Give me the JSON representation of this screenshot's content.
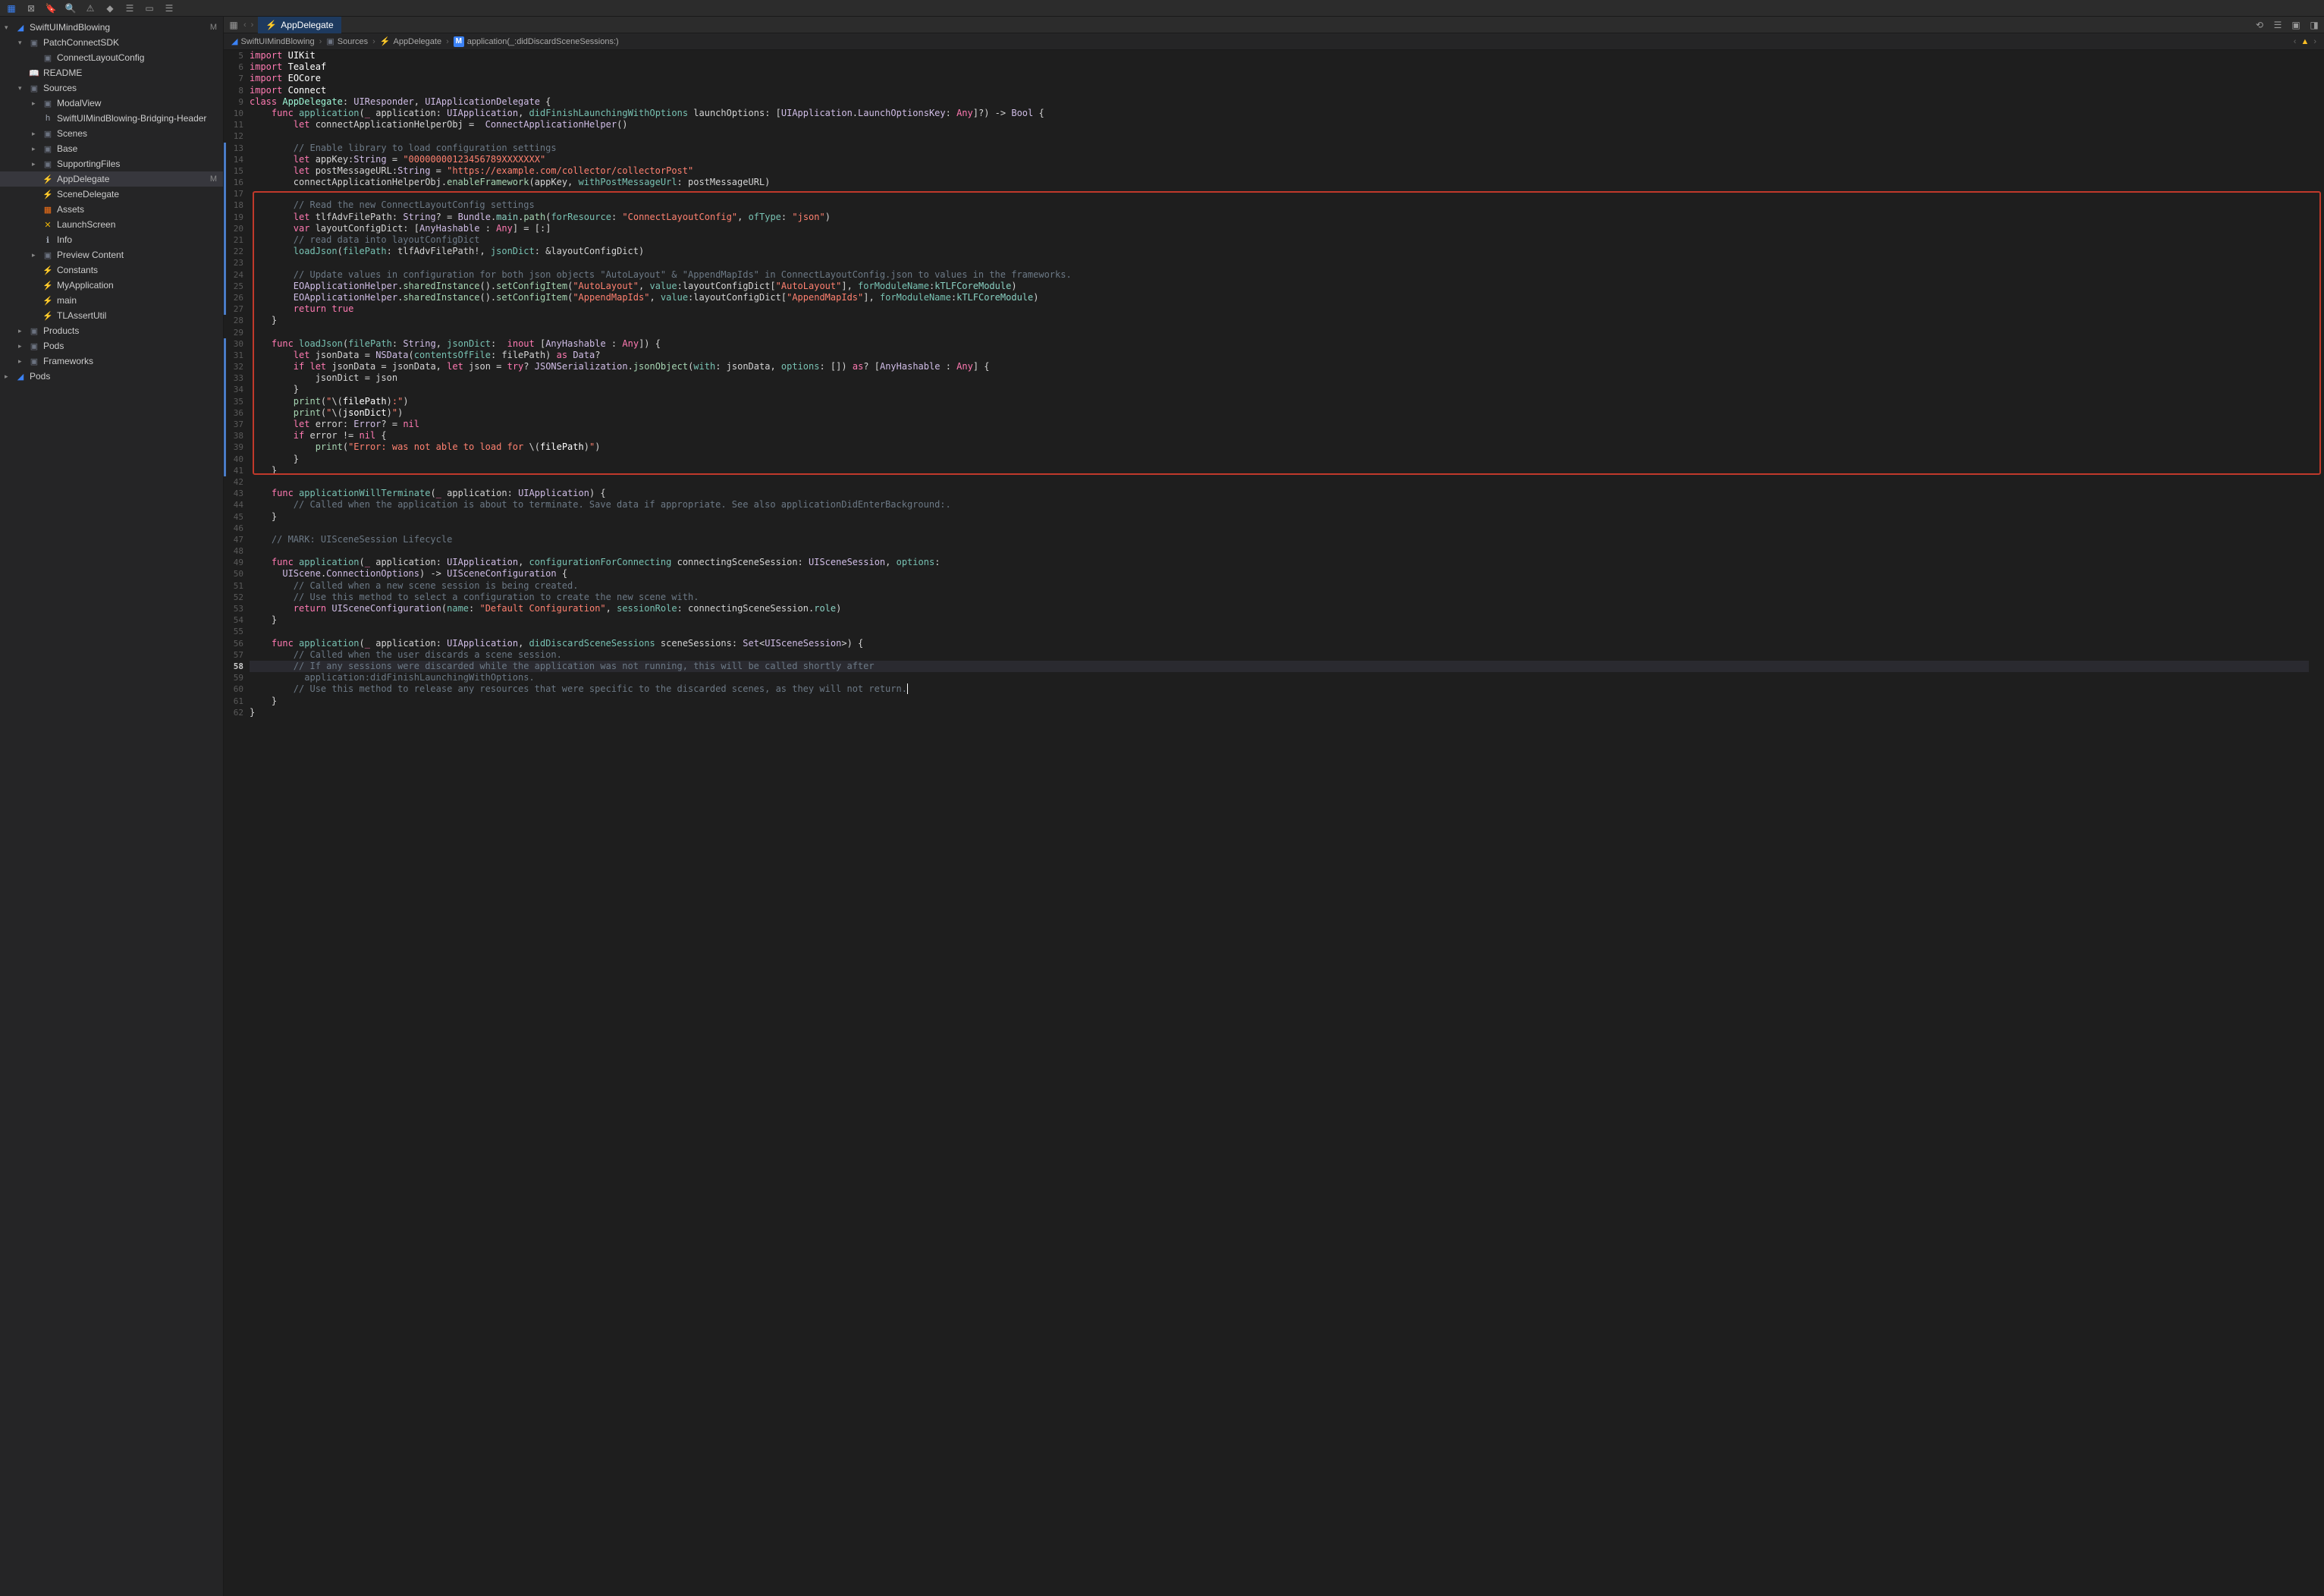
{
  "toolbar": {
    "icons": [
      "square-blue",
      "x-square",
      "bookmark",
      "search",
      "warning",
      "diamond",
      "git",
      "debug",
      "viewer",
      "list"
    ]
  },
  "editorToolbar": {
    "tabLabel": "AppDelegate"
  },
  "breadcrumb": {
    "root": "SwiftUIMindBlowing",
    "folder": "Sources",
    "file": "AppDelegate",
    "method": "application(_:didDiscardSceneSessions:)",
    "nav": {
      "prev": "‹",
      "next": "›"
    },
    "warnIcon": "warning-triangle"
  },
  "sidebar": {
    "items": [
      {
        "indent": 0,
        "chev": "▾",
        "iconClass": "icon-xcode",
        "icon": "◢",
        "label": "SwiftUIMindBlowing",
        "m": "M"
      },
      {
        "indent": 1,
        "chev": "▾",
        "iconClass": "icon-folder",
        "icon": "▣",
        "label": "PatchConnectSDK"
      },
      {
        "indent": 2,
        "chev": "",
        "iconClass": "icon-folder",
        "icon": "▣",
        "label": "ConnectLayoutConfig"
      },
      {
        "indent": 1,
        "chev": "",
        "iconClass": "icon-readme",
        "icon": "📖",
        "label": "README"
      },
      {
        "indent": 1,
        "chev": "▾",
        "iconClass": "icon-folder",
        "icon": "▣",
        "label": "Sources"
      },
      {
        "indent": 2,
        "chev": "▸",
        "iconClass": "icon-folder",
        "icon": "▣",
        "label": "ModalView"
      },
      {
        "indent": 2,
        "chev": "",
        "iconClass": "icon-h",
        "icon": "h",
        "label": "SwiftUIMindBlowing-Bridging-Header"
      },
      {
        "indent": 2,
        "chev": "▸",
        "iconClass": "icon-folder",
        "icon": "▣",
        "label": "Scenes"
      },
      {
        "indent": 2,
        "chev": "▸",
        "iconClass": "icon-folder",
        "icon": "▣",
        "label": "Base"
      },
      {
        "indent": 2,
        "chev": "▸",
        "iconClass": "icon-folder",
        "icon": "▣",
        "label": "SupportingFiles"
      },
      {
        "indent": 2,
        "chev": "",
        "iconClass": "icon-swift",
        "icon": "⚡",
        "label": "AppDelegate",
        "m": "M",
        "selected": true
      },
      {
        "indent": 2,
        "chev": "",
        "iconClass": "icon-swift",
        "icon": "⚡",
        "label": "SceneDelegate"
      },
      {
        "indent": 2,
        "chev": "",
        "iconClass": "icon-assets",
        "icon": "▦",
        "label": "Assets"
      },
      {
        "indent": 2,
        "chev": "",
        "iconClass": "icon-launch",
        "icon": "✕",
        "label": "LaunchScreen"
      },
      {
        "indent": 2,
        "chev": "",
        "iconClass": "icon-h",
        "icon": "ℹ",
        "label": "Info"
      },
      {
        "indent": 2,
        "chev": "▸",
        "iconClass": "icon-folder",
        "icon": "▣",
        "label": "Preview Content"
      },
      {
        "indent": 2,
        "chev": "",
        "iconClass": "icon-swift",
        "icon": "⚡",
        "label": "Constants"
      },
      {
        "indent": 2,
        "chev": "",
        "iconClass": "icon-swift",
        "icon": "⚡",
        "label": "MyApplication"
      },
      {
        "indent": 2,
        "chev": "",
        "iconClass": "icon-swift",
        "icon": "⚡",
        "label": "main"
      },
      {
        "indent": 2,
        "chev": "",
        "iconClass": "icon-swift",
        "icon": "⚡",
        "label": "TLAssertUtil"
      },
      {
        "indent": 1,
        "chev": "▸",
        "iconClass": "icon-folder",
        "icon": "▣",
        "label": "Products"
      },
      {
        "indent": 1,
        "chev": "▸",
        "iconClass": "icon-folder",
        "icon": "▣",
        "label": "Pods"
      },
      {
        "indent": 1,
        "chev": "▸",
        "iconClass": "icon-folder",
        "icon": "▣",
        "label": "Frameworks"
      },
      {
        "indent": 0,
        "chev": "▸",
        "iconClass": "icon-xcode",
        "icon": "◢",
        "label": "Pods"
      }
    ]
  },
  "code": {
    "startLine": 5,
    "currentLine": 58,
    "changeBars": [
      [
        13,
        16
      ],
      [
        17,
        27
      ],
      [
        30,
        41
      ]
    ],
    "highlightBox": {
      "startLine": 17,
      "endLine": 42
    },
    "lines": [
      "<span class='kw'>import</span> <span class='id'>UIKit</span>",
      "<span class='kw'>import</span> <span class='id'>Tealeaf</span>",
      "<span class='kw'>import</span> <span class='id'>EOCore</span>",
      "<span class='kw'>import</span> <span class='id'>Connect</span>",
      "<span class='kw'>class</span> <span class='type'>AppDelegate</span>: <span class='type2'>UIResponder</span>, <span class='type2'>UIApplicationDelegate</span> {",
      "    <span class='kw'>func</span> <span class='fn'>application</span>(<span class='kw'>_</span> application: <span class='type2'>UIApplication</span>, <span class='param'>didFinishLaunchingWithOptions</span> launchOptions: [<span class='type2'>UIApplication</span>.<span class='type2'>LaunchOptionsKey</span>: <span class='kw'>Any</span>]?) -> <span class='type2'>Bool</span> {",
      "        <span class='kw'>let</span> connectApplicationHelperObj =  <span class='type2'>ConnectApplicationHelper</span>()",
      "",
      "        <span class='cm'>// Enable library to load configuration settings</span>",
      "        <span class='kw'>let</span> appKey:<span class='type2'>String</span> = <span class='str'>\"00000000123456789XXXXXXX\"</span>",
      "        <span class='kw'>let</span> postMessageURL:<span class='type2'>String</span> = <span class='str'>\"https://example.com/collector/collectorPost\"</span>",
      "        connectApplicationHelperObj.<span class='fn2'>enableFramework</span>(appKey, <span class='param'>withPostMessageUrl</span>: postMessageURL)",
      "",
      "        <span class='cm'>// Read the new ConnectLayoutConfig settings</span>",
      "        <span class='kw'>let</span> tlfAdvFilePath: <span class='type2'>String</span>? = <span class='type2'>Bundle</span>.<span class='prop'>main</span>.<span class='fn2'>path</span>(<span class='param'>forResource</span>: <span class='str'>\"ConnectLayoutConfig\"</span>, <span class='param'>ofType</span>: <span class='str'>\"json\"</span>)",
      "        <span class='kw'>var</span> layoutConfigDict: [<span class='type2'>AnyHashable</span> : <span class='kw'>Any</span>] = [:]",
      "        <span class='cm'>// read data into layoutConfigDict</span>",
      "        <span class='fn'>loadJson</span>(<span class='param'>filePath</span>: tlfAdvFilePath!, <span class='param'>jsonDict</span>: &layoutConfigDict)",
      "",
      "        <span class='cm'>// Update values in configuration for both json objects \"AutoLayout\" & \"AppendMapIds\" in ConnectLayoutConfig.json to values in the frameworks.</span>",
      "        <span class='type2'>EOApplicationHelper</span>.<span class='fn2'>sharedInstance</span>().<span class='fn2'>setConfigItem</span>(<span class='str'>\"AutoLayout\"</span>, <span class='param'>value</span>:layoutConfigDict[<span class='str'>\"AutoLayout\"</span>], <span class='param'>forModuleName</span>:<span class='prop'>kTLFCoreModule</span>)",
      "        <span class='type2'>EOApplicationHelper</span>.<span class='fn2'>sharedInstance</span>().<span class='fn2'>setConfigItem</span>(<span class='str'>\"AppendMapIds\"</span>, <span class='param'>value</span>:layoutConfigDict[<span class='str'>\"AppendMapIds\"</span>], <span class='param'>forModuleName</span>:<span class='prop'>kTLFCoreModule</span>)",
      "        <span class='kw'>return</span> <span class='kw'>true</span>",
      "    }",
      "",
      "    <span class='kw'>func</span> <span class='fn'>loadJson</span>(<span class='param'>filePath</span>: <span class='type2'>String</span>, <span class='param'>jsonDict</span>:  <span class='kw'>inout</span> [<span class='type2'>AnyHashable</span> : <span class='kw'>Any</span>]) {",
      "        <span class='kw'>let</span> jsonData = <span class='type2'>NSData</span>(<span class='param'>contentsOfFile</span>: filePath) <span class='kw'>as</span> <span class='type2'>Data</span>?",
      "        <span class='kw'>if</span> <span class='kw'>let</span> jsonData = jsonData, <span class='kw'>let</span> json = <span class='kw'>try</span>? <span class='type2'>JSONSerialization</span>.<span class='fn2'>jsonObject</span>(<span class='param'>with</span>: jsonData, <span class='param'>options</span>: []) <span class='kw'>as</span>? [<span class='type2'>AnyHashable</span> : <span class='kw'>Any</span>] {",
      "            jsonDict = json",
      "        }",
      "        <span class='fn2'>print</span>(<span class='str'>\"</span>\\(<span class='id'>filePath</span>)<span class='str'>:\"</span>)",
      "        <span class='fn2'>print</span>(<span class='str'>\"</span>\\(<span class='id'>jsonDict</span>)<span class='str'>\"</span>)",
      "        <span class='kw'>let</span> error: <span class='type2'>Error</span>? = <span class='kw'>nil</span>",
      "        <span class='kw'>if</span> error != <span class='kw'>nil</span> {",
      "            <span class='fn2'>print</span>(<span class='str'>\"Error: was not able to load for </span>\\(<span class='id'>filePath</span>)<span class='str'>\"</span>)",
      "        }",
      "    }",
      "",
      "    <span class='kw'>func</span> <span class='fn'>applicationWillTerminate</span>(<span class='kw'>_</span> application: <span class='type2'>UIApplication</span>) {",
      "        <span class='cm'>// Called when the application is about to terminate. Save data if appropriate. See also applicationDidEnterBackground:.</span>",
      "    }",
      "",
      "    <span class='cm'>// MARK: UISceneSession Lifecycle</span>",
      "",
      "    <span class='kw'>func</span> <span class='fn'>application</span>(<span class='kw'>_</span> application: <span class='type2'>UIApplication</span>, <span class='param'>configurationForConnecting</span> connectingSceneSession: <span class='type2'>UISceneSession</span>, <span class='param'>options</span>:",
      "      <span class='type2'>UIScene</span>.<span class='type2'>ConnectionOptions</span>) -> <span class='type2'>UISceneConfiguration</span> {",
      "        <span class='cm'>// Called when a new scene session is being created.</span>",
      "        <span class='cm'>// Use this method to select a configuration to create the new scene with.</span>",
      "        <span class='kw'>return</span> <span class='type2'>UISceneConfiguration</span>(<span class='param'>name</span>: <span class='str'>\"Default Configuration\"</span>, <span class='param'>sessionRole</span>: connectingSceneSession.<span class='prop'>role</span>)",
      "    }",
      "",
      "    <span class='kw'>func</span> <span class='fn'>application</span>(<span class='kw'>_</span> application: <span class='type2'>UIApplication</span>, <span class='param'>didDiscardSceneSessions</span> sceneSessions: <span class='type2'>Set</span>&lt;<span class='type2'>UISceneSession</span>&gt;) {",
      "        <span class='cm'>// Called when the user discards a scene session.</span>",
      "        <span class='cm'>// If any sessions were discarded while the application was not running, this will be called shortly after</span>",
      "          <span class='cm'>application:didFinishLaunchingWithOptions.</span>",
      "        <span class='cm'>// Use this method to release any resources that were specific to the discarded scenes, as they will not return.</span><span class='cursor-mark'></span>",
      "    }",
      "}"
    ]
  }
}
